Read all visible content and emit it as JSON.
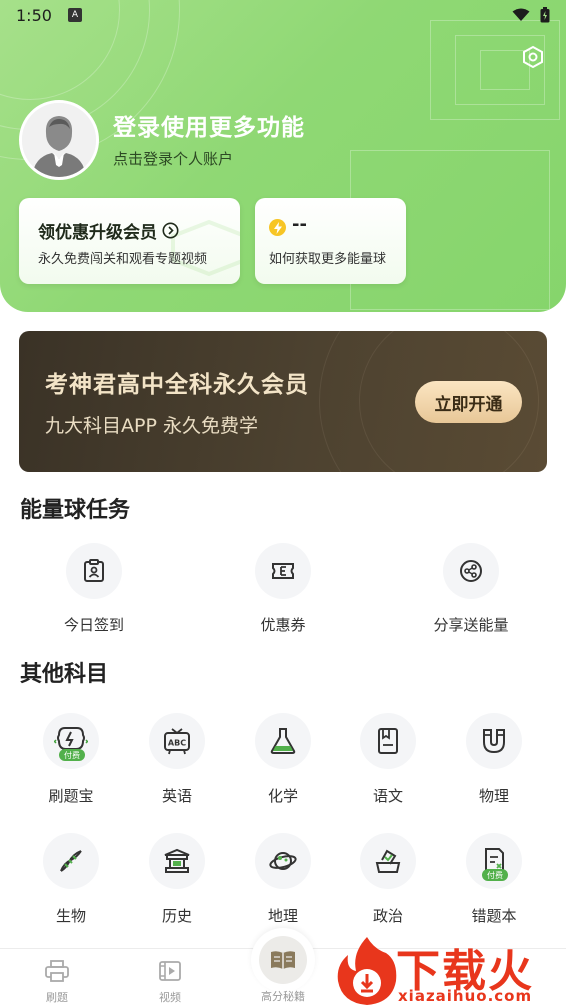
{
  "status_bar": {
    "time": "1:50",
    "notif_letter": "A"
  },
  "profile": {
    "title": "登录使用更多功能",
    "subtitle": "点击登录个人账户"
  },
  "member_card": {
    "title": "领优惠升级会员",
    "subtitle": "永久免费闯关和观看专题视频"
  },
  "energy_card": {
    "value": "--",
    "subtitle": "如何获取更多能量球"
  },
  "banner": {
    "title": "考神君高中全科永久会员",
    "subtitle": "九大科目APP 永久免费学",
    "button": "立即开通"
  },
  "energy_tasks": {
    "title": "能量球任务",
    "items": [
      {
        "label": "今日签到",
        "icon": "sign-in-icon"
      },
      {
        "label": "优惠券",
        "icon": "coupon-icon"
      },
      {
        "label": "分享送能量",
        "icon": "share-icon"
      }
    ]
  },
  "other_subjects": {
    "title": "其他科目",
    "paid_badge": "付费",
    "items": [
      {
        "label": "刷题宝",
        "icon": "code-brain-icon"
      },
      {
        "label": "英语",
        "icon": "abc-board-icon"
      },
      {
        "label": "化学",
        "icon": "flask-icon"
      },
      {
        "label": "语文",
        "icon": "book-icon"
      },
      {
        "label": "物理",
        "icon": "magnet-icon"
      },
      {
        "label": "生物",
        "icon": "dna-icon"
      },
      {
        "label": "历史",
        "icon": "temple-icon"
      },
      {
        "label": "地理",
        "icon": "planet-icon"
      },
      {
        "label": "政治",
        "icon": "ballot-icon"
      },
      {
        "label": "错题本",
        "icon": "wrong-notebook-icon"
      }
    ]
  },
  "bottom_nav": {
    "items": [
      {
        "label": "刷题",
        "icon": "printer-icon"
      },
      {
        "label": "视频",
        "icon": "video-icon"
      },
      {
        "label": "高分秘籍",
        "icon": "open-book-icon"
      }
    ]
  },
  "watermark": {
    "text": "下载火",
    "url": "xiazaihuo.com"
  },
  "colors": {
    "header_green": "#8fd874",
    "banner_dark": "#4d4230",
    "banner_button": "#f2d6ab",
    "watermark_red": "#e8361c"
  }
}
